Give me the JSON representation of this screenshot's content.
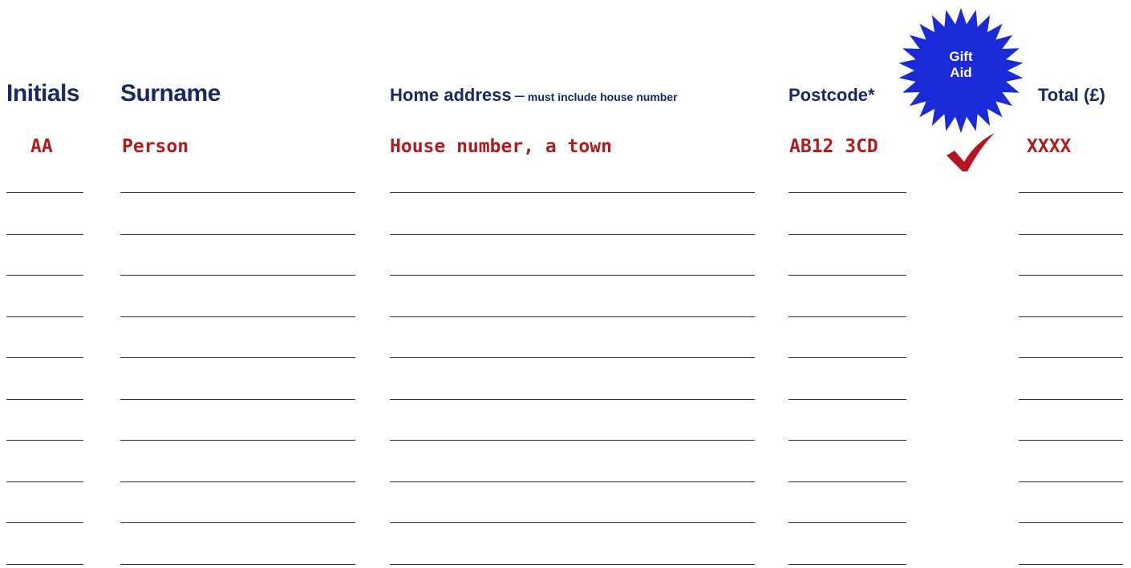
{
  "badge": {
    "label_line1": "Gift",
    "label_line2": "Aid",
    "color": "#1a2ad8"
  },
  "headers": {
    "initials": "Initials",
    "surname": "Surname",
    "address_main": "Home address",
    "address_dash": "–",
    "address_note": "must include house number",
    "postcode": "Postcode*",
    "total": "Total (£)"
  },
  "example_row": {
    "initials": "AA",
    "surname": "Person",
    "address": "House number, a town",
    "postcode": "AB12 3CD",
    "gift_aid_icon": "checkmark-icon",
    "total": "XXXX"
  },
  "blank_rows": 10,
  "colors": {
    "header_navy": "#162a63",
    "example_red": "#b01c1c",
    "badge_blue": "#1a2ad8",
    "tick_red": "#b3161f"
  }
}
